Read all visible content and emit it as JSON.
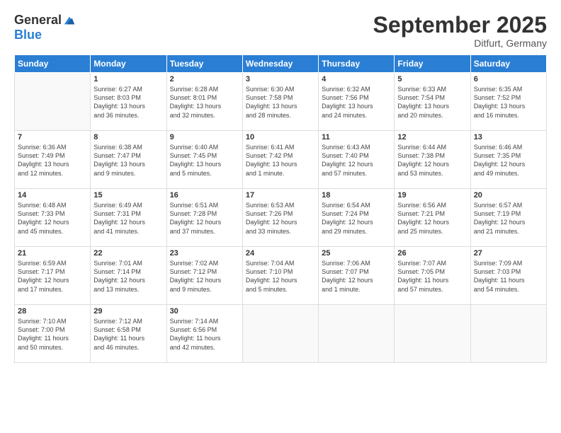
{
  "logo": {
    "general": "General",
    "blue": "Blue"
  },
  "title": "September 2025",
  "location": "Ditfurt, Germany",
  "days_header": [
    "Sunday",
    "Monday",
    "Tuesday",
    "Wednesday",
    "Thursday",
    "Friday",
    "Saturday"
  ],
  "weeks": [
    [
      {
        "day": "",
        "info": ""
      },
      {
        "day": "1",
        "info": "Sunrise: 6:27 AM\nSunset: 8:03 PM\nDaylight: 13 hours\nand 36 minutes."
      },
      {
        "day": "2",
        "info": "Sunrise: 6:28 AM\nSunset: 8:01 PM\nDaylight: 13 hours\nand 32 minutes."
      },
      {
        "day": "3",
        "info": "Sunrise: 6:30 AM\nSunset: 7:58 PM\nDaylight: 13 hours\nand 28 minutes."
      },
      {
        "day": "4",
        "info": "Sunrise: 6:32 AM\nSunset: 7:56 PM\nDaylight: 13 hours\nand 24 minutes."
      },
      {
        "day": "5",
        "info": "Sunrise: 6:33 AM\nSunset: 7:54 PM\nDaylight: 13 hours\nand 20 minutes."
      },
      {
        "day": "6",
        "info": "Sunrise: 6:35 AM\nSunset: 7:52 PM\nDaylight: 13 hours\nand 16 minutes."
      }
    ],
    [
      {
        "day": "7",
        "info": "Sunrise: 6:36 AM\nSunset: 7:49 PM\nDaylight: 13 hours\nand 12 minutes."
      },
      {
        "day": "8",
        "info": "Sunrise: 6:38 AM\nSunset: 7:47 PM\nDaylight: 13 hours\nand 9 minutes."
      },
      {
        "day": "9",
        "info": "Sunrise: 6:40 AM\nSunset: 7:45 PM\nDaylight: 13 hours\nand 5 minutes."
      },
      {
        "day": "10",
        "info": "Sunrise: 6:41 AM\nSunset: 7:42 PM\nDaylight: 13 hours\nand 1 minute."
      },
      {
        "day": "11",
        "info": "Sunrise: 6:43 AM\nSunset: 7:40 PM\nDaylight: 12 hours\nand 57 minutes."
      },
      {
        "day": "12",
        "info": "Sunrise: 6:44 AM\nSunset: 7:38 PM\nDaylight: 12 hours\nand 53 minutes."
      },
      {
        "day": "13",
        "info": "Sunrise: 6:46 AM\nSunset: 7:35 PM\nDaylight: 12 hours\nand 49 minutes."
      }
    ],
    [
      {
        "day": "14",
        "info": "Sunrise: 6:48 AM\nSunset: 7:33 PM\nDaylight: 12 hours\nand 45 minutes."
      },
      {
        "day": "15",
        "info": "Sunrise: 6:49 AM\nSunset: 7:31 PM\nDaylight: 12 hours\nand 41 minutes."
      },
      {
        "day": "16",
        "info": "Sunrise: 6:51 AM\nSunset: 7:28 PM\nDaylight: 12 hours\nand 37 minutes."
      },
      {
        "day": "17",
        "info": "Sunrise: 6:53 AM\nSunset: 7:26 PM\nDaylight: 12 hours\nand 33 minutes."
      },
      {
        "day": "18",
        "info": "Sunrise: 6:54 AM\nSunset: 7:24 PM\nDaylight: 12 hours\nand 29 minutes."
      },
      {
        "day": "19",
        "info": "Sunrise: 6:56 AM\nSunset: 7:21 PM\nDaylight: 12 hours\nand 25 minutes."
      },
      {
        "day": "20",
        "info": "Sunrise: 6:57 AM\nSunset: 7:19 PM\nDaylight: 12 hours\nand 21 minutes."
      }
    ],
    [
      {
        "day": "21",
        "info": "Sunrise: 6:59 AM\nSunset: 7:17 PM\nDaylight: 12 hours\nand 17 minutes."
      },
      {
        "day": "22",
        "info": "Sunrise: 7:01 AM\nSunset: 7:14 PM\nDaylight: 12 hours\nand 13 minutes."
      },
      {
        "day": "23",
        "info": "Sunrise: 7:02 AM\nSunset: 7:12 PM\nDaylight: 12 hours\nand 9 minutes."
      },
      {
        "day": "24",
        "info": "Sunrise: 7:04 AM\nSunset: 7:10 PM\nDaylight: 12 hours\nand 5 minutes."
      },
      {
        "day": "25",
        "info": "Sunrise: 7:06 AM\nSunset: 7:07 PM\nDaylight: 12 hours\nand 1 minute."
      },
      {
        "day": "26",
        "info": "Sunrise: 7:07 AM\nSunset: 7:05 PM\nDaylight: 11 hours\nand 57 minutes."
      },
      {
        "day": "27",
        "info": "Sunrise: 7:09 AM\nSunset: 7:03 PM\nDaylight: 11 hours\nand 54 minutes."
      }
    ],
    [
      {
        "day": "28",
        "info": "Sunrise: 7:10 AM\nSunset: 7:00 PM\nDaylight: 11 hours\nand 50 minutes."
      },
      {
        "day": "29",
        "info": "Sunrise: 7:12 AM\nSunset: 6:58 PM\nDaylight: 11 hours\nand 46 minutes."
      },
      {
        "day": "30",
        "info": "Sunrise: 7:14 AM\nSunset: 6:56 PM\nDaylight: 11 hours\nand 42 minutes."
      },
      {
        "day": "",
        "info": ""
      },
      {
        "day": "",
        "info": ""
      },
      {
        "day": "",
        "info": ""
      },
      {
        "day": "",
        "info": ""
      }
    ]
  ]
}
